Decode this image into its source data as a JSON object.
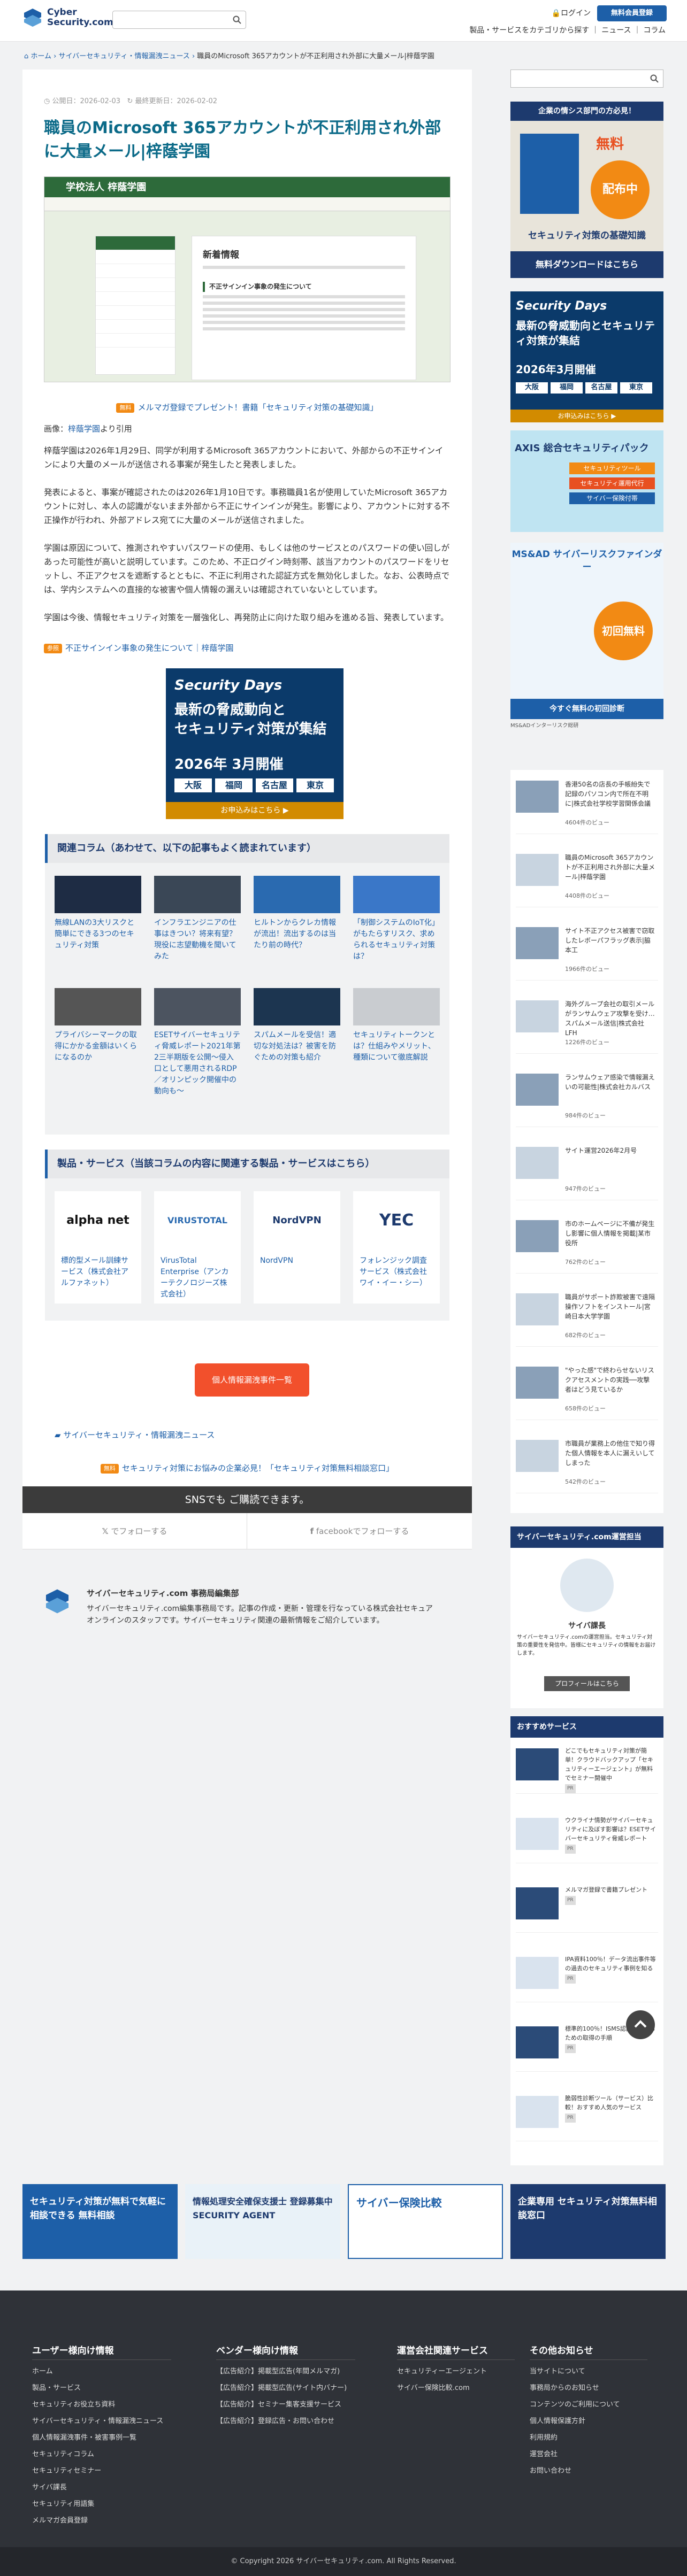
{
  "header": {
    "logo_line1": "Cyber",
    "logo_line2": "Security.com",
    "login": "ログイン",
    "register": "無料会員登録",
    "subnav": "製品・サービスをカテゴリから探す ｜ ニュース ｜ コラム"
  },
  "breadcrumb": {
    "home": "ホーム",
    "parent": "サイバーセキュリティ・情報漏洩ニュース",
    "current": "職員のMicrosoft 365アカウントが不正利用され外部に大量メール|梓蔭学園"
  },
  "article": {
    "published": "公開日：2026-02-03",
    "updated": "最終更新日：2026-02-02",
    "title": "職員のMicrosoft 365アカウントが不正利用され外部に大量メール|梓蔭学園",
    "hero_school": "学校法人 梓蔭学園",
    "hero_heading": "新着情報",
    "hero_notice": "不正サインイン事象の発生について",
    "promo_tag": "無料",
    "promo_text": "メルマガ登録でプレゼント！書籍「セキュリティ対策の基礎知識」",
    "source_prefix": "画像：",
    "source_link": "梓蔭学園",
    "source_suffix": "より引用",
    "p1": "梓蔭学園は2026年1月29日、同学が利用するMicrosoft 365アカウントにおいて、外部からの不正サインインにより大量のメールが送信される事案が発生したと発表しました。",
    "p2": "発表によると、事案が確認されたのは2026年1月10日です。事務職員1名が使用していたMicrosoft 365アカウントに対し、本人の認識がないまま外部から不正にサインインが発生。影響により、アカウントに対する不正操作が行われ、外部アドレス宛てに大量のメールが送信されました。",
    "p3": "学園は原因について、推測されやすいパスワードの使用、もしくは他のサービスとのパスワードの使い回しがあった可能性が高いと説明しています。このため、不正ログイン時刻帯、該当アカウントのパスワードをリセットし、不正アクセスを遮断するとともに、不正に利用された認証方式を無効化しました。なお、公表時点では、学内システムへの直接的な被害や個人情報の漏えいは確認されていないとしています。",
    "p4": "学園は今後、情報セキュリティ対策を一層強化し、再発防止に向けた取り組みを進める旨、発表しています。",
    "ref_tag": "参照",
    "ref_link": "不正サインイン事象の発生について｜梓蔭学園"
  },
  "ad_security_days": {
    "brand": "Security Days",
    "headline1": "最新の脅威動向と",
    "headline2": "セキュリティ対策が集結",
    "date": "2026年 3月開催",
    "cities": [
      "大阪",
      "福岡",
      "名古屋",
      "東京"
    ],
    "cta": "お申込みはこちら ▶"
  },
  "related": {
    "heading": "関連コラム（あわせて、以下の記事もよく読まれています）",
    "items": [
      "無線LANの3大リスクと簡単にできる3つのセキュリティ対策",
      "インフラエンジニアの仕事はきつい？将来有望？現役に志望動機を聞いてみた",
      "ヒルトンからクレカ情報が流出！流出するのは当たり前の時代？",
      "「制御システムのIoT化」がもたらすリスク、求められるセキュリティ対策は？",
      "プライバシーマークの取得にかかる金額はいくらになるのか",
      "ESETサイバーセキュリティ脅威レポート2021年第2三半期版を公開〜侵入口として悪用されるRDP／オリンピック開催中の動向も〜",
      "スパムメールを受信！適切な対処法は？被害を防ぐための対策も紹介",
      "セキュリティトークンとは？仕組みやメリット、種類について徹底解説"
    ]
  },
  "products": {
    "heading": "製品・サービス（当該コラムの内容に関連する製品・サービスはこちら）",
    "items": [
      {
        "logo": "alpha net",
        "name": "標的型メール訓練サービス（株式会社アルファネット）"
      },
      {
        "logo": "VIRUSTOTAL",
        "name": "VirusTotal Enterprise（アンカーテクノロジーズ株式会社）"
      },
      {
        "logo": "NordVPN",
        "name": "NordVPN"
      },
      {
        "logo": "YEC",
        "name": "フォレンジック調査サービス（株式会社ワイ・イー・シー）"
      }
    ]
  },
  "leak_button": "個人情報漏洩事件一覧",
  "news_link": "サイバーセキュリティ・情報漏洩ニュース",
  "consult_tag": "無料",
  "consult_text": "セキュリティ対策にお悩みの企業必見！「セキュリティ対策無料相談窓口」",
  "sns": {
    "heading": "SNSでも ご購読できます。",
    "x": "でフォローする",
    "facebook": "facebookでフォローする"
  },
  "author": {
    "name": "サイバーセキュリティ.com 事務局編集部",
    "desc": "サイバーセキュリティ.com編集事務局です。記事の作成・更新・管理を行なっている株式会社セキュアオンラインのスタッフです。サイバーセキュリティ関連の最新情報をご紹介しています。"
  },
  "sidebar": {
    "ad_book_line1": "企業の情シス部門の方必見！",
    "ad_book_free": "無料",
    "ad_book_gift": "配布中",
    "ad_book_title": "セキュリティ対策の基礎知識",
    "ad_book_cta": "無料ダウンロードはこちら",
    "ad_sd_brand": "Security Days",
    "ad_sd_head": "最新の脅威動向とセキュリティ対策が集結",
    "ad_sd_date": "2026年3月開催",
    "ad_axis_title": "AXIS 総合セキュリティパック",
    "ad_axis_items": [
      "セキュリティツール",
      "セキュリティ運用代行",
      "サイバー保険付帯"
    ],
    "ad_ms_title": "MS&AD サイバーリスクファインダー",
    "ad_ms_free": "初回無料",
    "ad_ms_cta": "今すぐ無料の初回診断",
    "ad_ms_caption": "MS&ADインターリスク総研",
    "ranking": [
      {
        "title": "香港50名の店長の手帳紛失で記録のパソコン内で所在不明に|株式会社学校学習関係会議",
        "views": "4604件のビュー"
      },
      {
        "title": "職員のMicrosoft 365アカウントが不正利用され外部に大量メール|梓蔭学園",
        "views": "4408件のビュー"
      },
      {
        "title": "サイト不正アクセス被害で窃取したレボーパフラッグ表示|脇本工",
        "views": "1966件のビュー"
      },
      {
        "title": "海外グループ会社の取引メールがランサムウェア攻撃を受け…スパムメール送信|株式会社LFH",
        "views": "1226件のビュー"
      },
      {
        "title": "ランサムウェア感染で情報漏えいの可能性|株式会社カルバス",
        "views": "984件のビュー"
      },
      {
        "title": "サイト運営2026年2月号",
        "views": "947件のビュー"
      },
      {
        "title": "市のホームページに不備が発生し影響に個人情報を掲載|某市役所",
        "views": "762件のビュー"
      },
      {
        "title": "職員がサポート詐欺被害で遠隔操作ソフトをインストール|宮崎日本大学学園",
        "views": "682件のビュー"
      },
      {
        "title": "\"やった感\"で終わらせないリスクアセスメントの実践──攻撃者はどう見ているか",
        "views": "658件のビュー"
      },
      {
        "title": "市職員が業務上の他住で知り得た個人情報を本人に漏えいしてしまった",
        "views": "542件のビュー"
      }
    ],
    "mascot_head": "サイバーセキュリティ.com運営担当",
    "mascot_name": "サイバ課長",
    "mascot_desc": "サイバーセキュリティ.comの運営担当。セキュリティ対策の重要性を発信中。皆様にセキュリティの情報をお届けします。",
    "mascot_btn": "プロフィールはこちら",
    "svc_head": "おすすめサービス",
    "services": [
      "どこでもセキュリティ対策が簡単！クラウドバックアップ「セキュリティーエージェント」が無料でセミナー開催中",
      "ウクライナ情勢がサイバーセキュリティに及ぼす影響は？ESETサイバーセキュリティ脅威レポート",
      "メルマガ登録で書籍プレゼント",
      "IPA資料100％！データ流出事件等の過去のセキュリティ事例を知る",
      "標準的100％！ISMS認証取得するための取得の手順",
      "脆弱性診断ツール（サービス）比較！おすすめ人気のサービス"
    ],
    "svc_pr": "PR"
  },
  "banners": [
    "セキュリティ対策が無料で気軽に相談できる 無料相談",
    "情報処理安全確保支援士 登録募集中 SECURITY AGENT",
    "サイバー保険比較",
    "企業専用 セキュリティ対策無料相談窓口"
  ],
  "footer": {
    "col1_head": "ユーザー様向け情報",
    "col1": [
      "ホーム",
      "製品・サービス",
      "セキュリティお役立ち資料",
      "サイバーセキュリティ・情報漏洩ニュース",
      "個人情報漏洩事件・被害事例一覧",
      "セキュリティコラム",
      "セキュリティセミナー",
      "サイバ課長",
      "セキュリティ用語集",
      "メルマガ会員登録"
    ],
    "col2_head": "ベンダー様向け情報",
    "col2": [
      "【広告紹介】掲載型広告(年間メルマガ)",
      "【広告紹介】掲載型広告(サイト内バナー)",
      "【広告紹介】セミナー集客支援サービス",
      "【広告紹介】登録広告・お問い合わせ"
    ],
    "col3_head": "運営会社関連サービス",
    "col3": [
      "セキュリティーエージェント",
      "サイバー保険比較.com"
    ],
    "col4_head": "その他お知らせ",
    "col4": [
      "当サイトについて",
      "事務局からのお知らせ",
      "コンテンツのご利用について",
      "個人情報保護方針",
      "利用規約",
      "運営会社",
      "お問い合わせ"
    ],
    "copyright": "© Copyright 2026 サイバーセキュリティ.com. All Rights Reserved."
  },
  "colors": {
    "accent": "#1d5fa8",
    "title": "#0b6a88",
    "orange": "#f28a14",
    "red": "#f2502c",
    "dark": "#2f3238"
  }
}
